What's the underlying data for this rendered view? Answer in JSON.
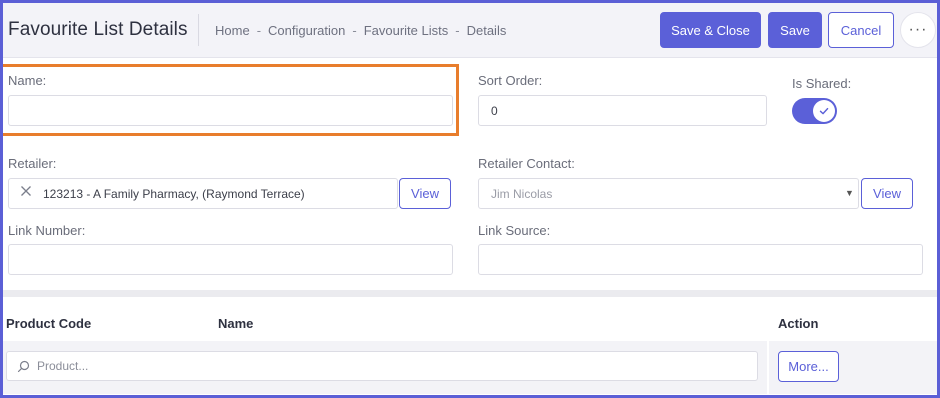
{
  "header": {
    "title": "Favourite List Details",
    "breadcrumb": [
      "Home",
      "Configuration",
      "Favourite Lists",
      "Details"
    ],
    "breadcrumb_separator": "-",
    "save_close_label": "Save & Close",
    "save_label": "Save",
    "cancel_label": "Cancel",
    "more_label": "···"
  },
  "form": {
    "name": {
      "label": "Name:",
      "value": ""
    },
    "sort_order": {
      "label": "Sort Order:",
      "value": "0"
    },
    "is_shared": {
      "label": "Is Shared:",
      "checked": true
    },
    "retailer": {
      "label": "Retailer:",
      "value": "123213 - A Family Pharmacy, (Raymond Terrace)",
      "view_label": "View"
    },
    "retailer_contact": {
      "label": "Retailer Contact:",
      "value": "Jim Nicolas",
      "view_label": "View"
    },
    "link_number": {
      "label": "Link Number:",
      "value": ""
    },
    "link_source": {
      "label": "Link Source:",
      "value": ""
    }
  },
  "table": {
    "columns": [
      "Product Code",
      "Name",
      "Action"
    ],
    "search_placeholder": "Product...",
    "more_label": "More..."
  },
  "colors": {
    "accent": "#5b60d8",
    "highlight": "#e87d2c",
    "frame": "#5b5fd6"
  }
}
